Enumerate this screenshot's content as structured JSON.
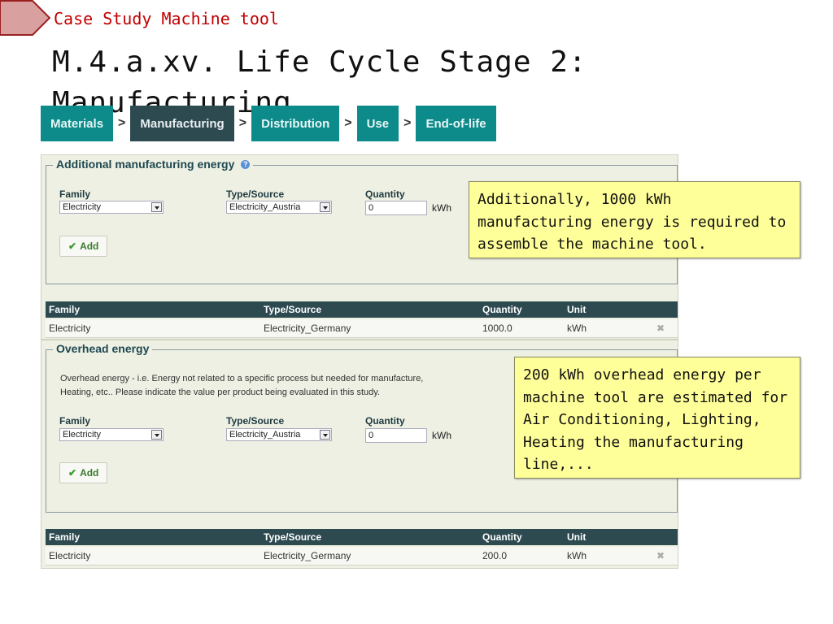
{
  "header": {
    "case_label": "Case Study Machine tool",
    "title": "M.4.a.xv. Life Cycle Stage 2: Manufacturing"
  },
  "steps": [
    {
      "label": "Materials",
      "active": false
    },
    {
      "label": "Manufacturing",
      "active": true
    },
    {
      "label": "Distribution",
      "active": false
    },
    {
      "label": "Use",
      "active": false
    },
    {
      "label": "End-of-life",
      "active": false
    }
  ],
  "step_separator": ">",
  "additional": {
    "legend": "Additional manufacturing energy",
    "family_label": "Family",
    "family_value": "Electricity",
    "type_label": "Type/Source",
    "type_value": "Electricity_Austria",
    "qty_label": "Quantity",
    "qty_value": "0",
    "unit": "kWh",
    "add_label": "Add"
  },
  "table_headers": {
    "family": "Family",
    "type": "Type/Source",
    "quantity": "Quantity",
    "unit": "Unit"
  },
  "additional_rows": [
    {
      "family": "Electricity",
      "type": "Electricity_Germany",
      "quantity": "1000.0",
      "unit": "kWh"
    }
  ],
  "overhead": {
    "legend": "Overhead energy",
    "desc_line1": "Overhead energy - i.e. Energy not related to a specific process but needed for manufacture,",
    "desc_line2": "Heating, etc.. Please indicate the value per product being evaluated in this study.",
    "family_label": "Family",
    "family_value": "Electricity",
    "type_label": "Type/Source",
    "type_value": "Electricity_Austria",
    "qty_label": "Quantity",
    "qty_value": "0",
    "unit": "kWh",
    "add_label": "Add"
  },
  "overhead_rows": [
    {
      "family": "Electricity",
      "type": "Electricity_Germany",
      "quantity": "200.0",
      "unit": "kWh"
    }
  ],
  "callouts": {
    "first": "Additionally, 1000 kWh manufacturing energy is required to assemble the machine tool.",
    "second": "200 kWh overhead energy per machine tool are estimated for Air Conditioning, Lighting, Heating the manufacturing line,..."
  },
  "icons": {
    "help": "help-icon",
    "add": "checkmark-icon",
    "delete": "close-icon",
    "dropdown": "chevron-down-icon"
  },
  "colors": {
    "step_bg": "#0d8a8a",
    "step_active_bg": "#2d4a50",
    "table_header_bg": "#2d4a50",
    "case_label": "#c00000",
    "callout_bg": "#ffff99"
  }
}
